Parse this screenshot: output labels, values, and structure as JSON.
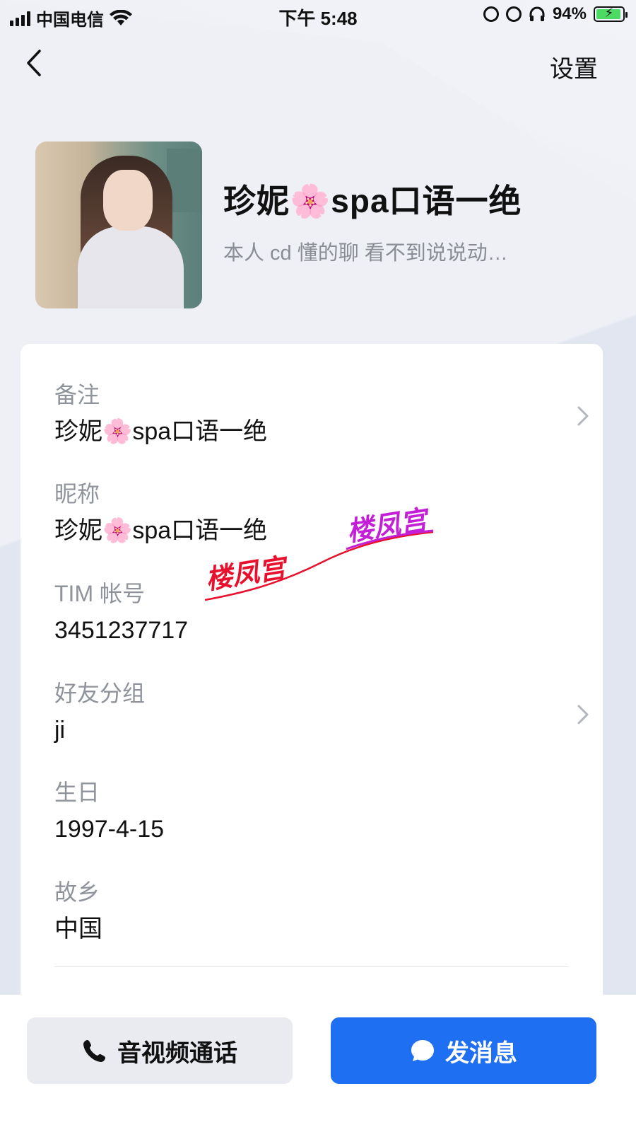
{
  "status_bar": {
    "carrier": "中国电信",
    "time": "下午 5:48",
    "battery": "94%"
  },
  "nav": {
    "back_icon": "chevron-left-icon",
    "settings_label": "设置"
  },
  "profile": {
    "name": "珍妮🌸spa口语一绝",
    "signature": "本人 cd 懂的聊 看不到说说动…"
  },
  "info": [
    {
      "label": "备注",
      "value": "珍妮🌸spa口语一绝",
      "has_chevron": true
    },
    {
      "label": "昵称",
      "value": "珍妮🌸spa口语一绝",
      "has_chevron": false
    },
    {
      "label": "TIM 帐号",
      "value": "3451237717",
      "has_chevron": false
    },
    {
      "label": "好友分组",
      "value": "ji",
      "has_chevron": true
    },
    {
      "label": "生日",
      "value": "1997-4-15",
      "has_chevron": false
    },
    {
      "label": "故乡",
      "value": "中国",
      "has_chevron": false
    }
  ],
  "watermark": {
    "red": "楼凤宫",
    "purple": "楼凤宫"
  },
  "actions": {
    "call_label": "音视频通话",
    "call_icon": "phone-icon",
    "message_label": "发消息",
    "message_icon": "chat-bubble-icon"
  },
  "colors": {
    "accent": "#1f6ff2",
    "watermark_red": "#e8112d",
    "watermark_purple": "#c21fd6"
  }
}
